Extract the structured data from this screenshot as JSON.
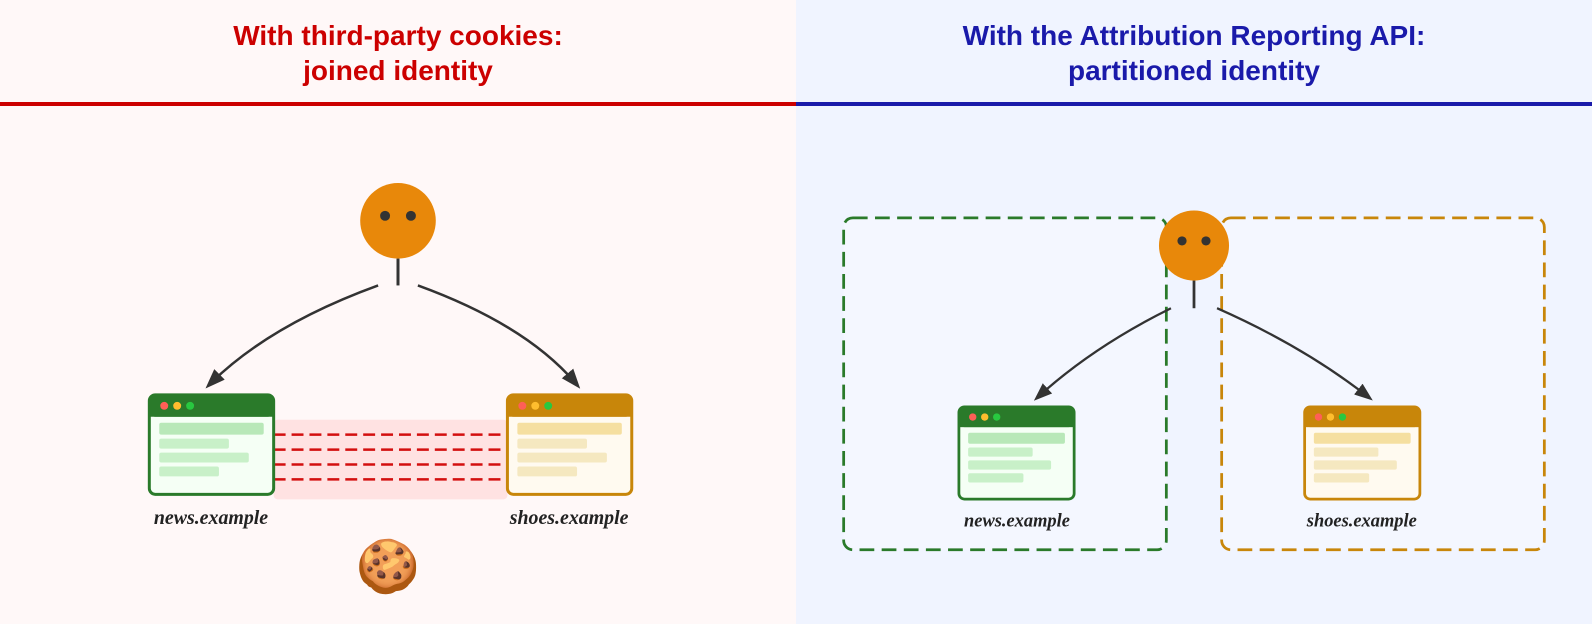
{
  "left": {
    "title_line1": "With third-party cookies:",
    "title_line2": "joined identity",
    "label1": "news.example",
    "label2": "shoes.example"
  },
  "right": {
    "title_line1": "With the Attribution Reporting API:",
    "title_line2": "partitioned identity",
    "label1": "news.example",
    "label2": "shoes.example"
  }
}
